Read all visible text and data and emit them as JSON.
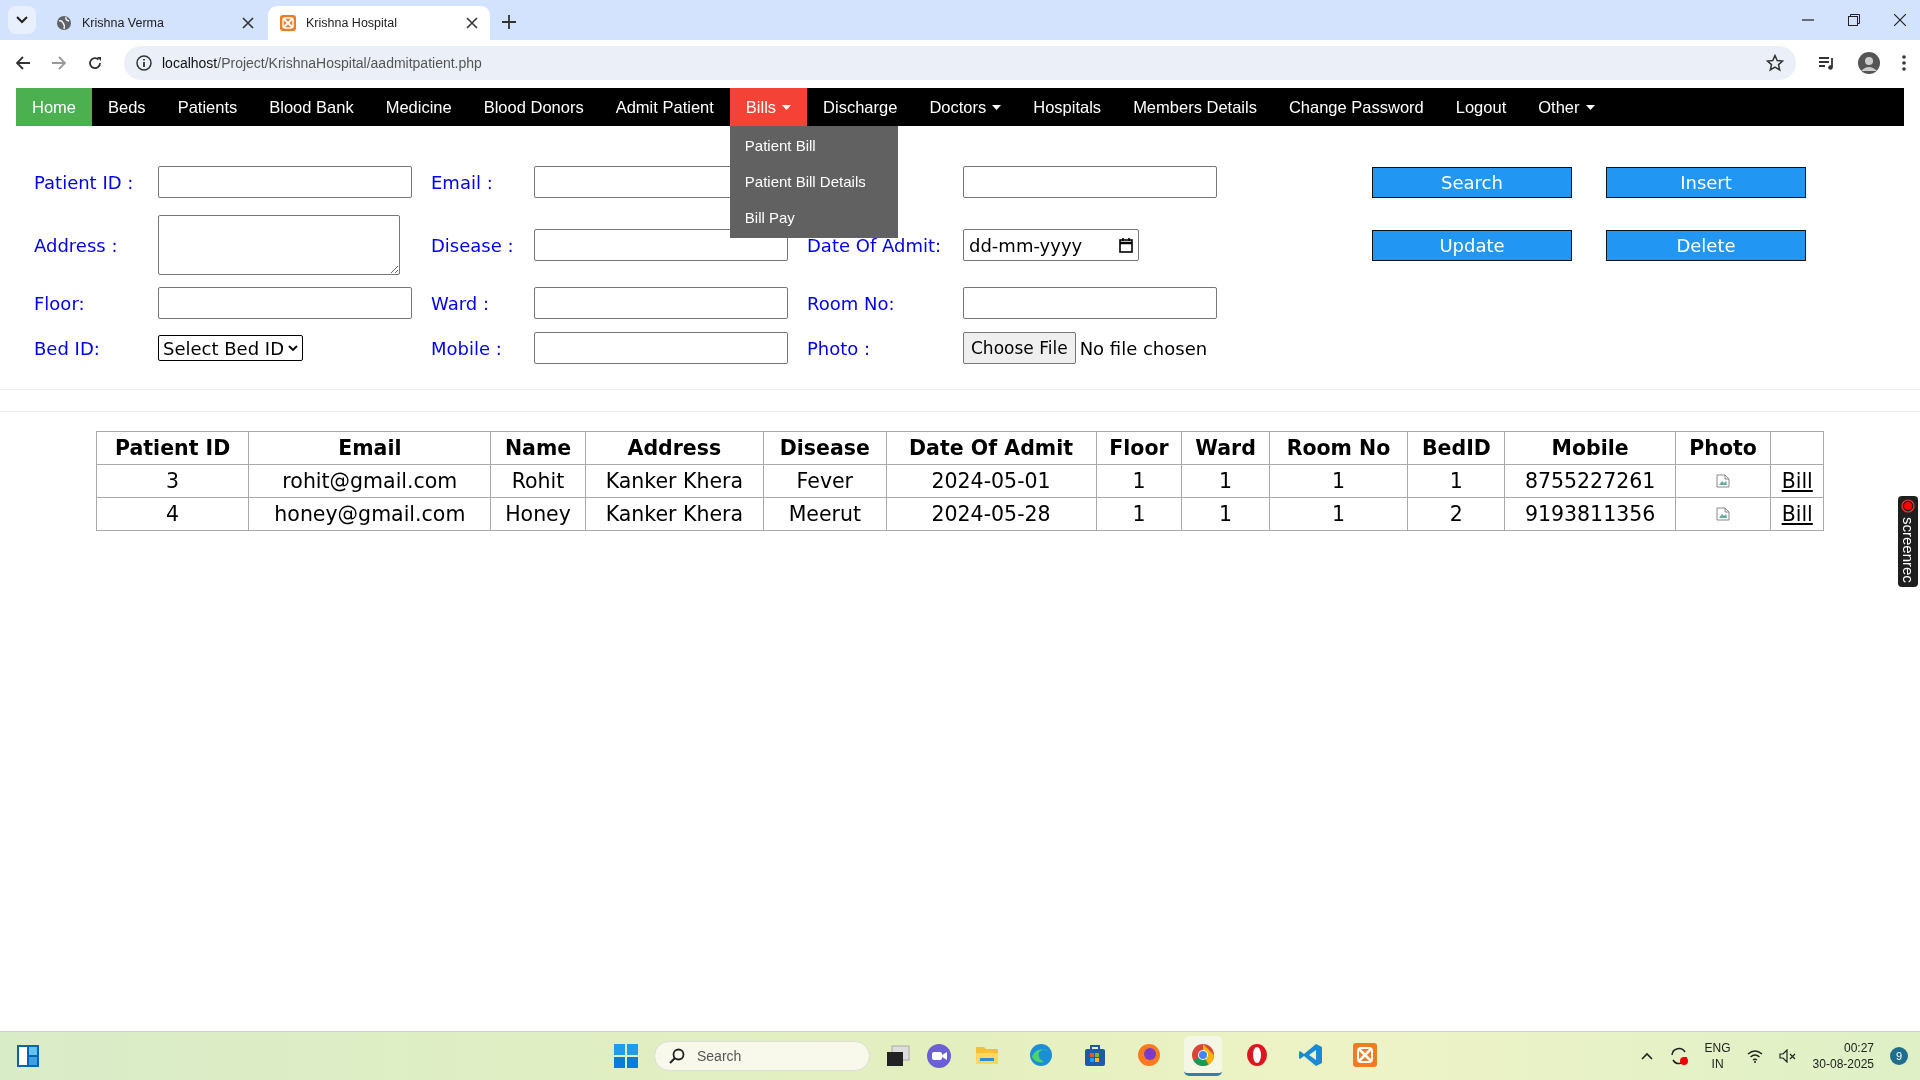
{
  "browser": {
    "tabs": [
      {
        "title": "Krishna Verma",
        "selected": false
      },
      {
        "title": "Krishna Hospital",
        "selected": true
      }
    ],
    "url_host": "localhost",
    "url_path": "/Project/KrishnaHospital/aadmitpatient.php"
  },
  "nav": {
    "items": [
      {
        "label": "Home",
        "selected": true,
        "caret": false,
        "open": false
      },
      {
        "label": "Beds",
        "selected": false,
        "caret": false,
        "open": false
      },
      {
        "label": "Patients",
        "selected": false,
        "caret": false,
        "open": false
      },
      {
        "label": "Blood Bank",
        "selected": false,
        "caret": false,
        "open": false
      },
      {
        "label": "Medicine",
        "selected": false,
        "caret": false,
        "open": false
      },
      {
        "label": "Blood Donors",
        "selected": false,
        "caret": false,
        "open": false
      },
      {
        "label": "Admit Patient",
        "selected": false,
        "caret": false,
        "open": false
      },
      {
        "label": "Bills",
        "selected": false,
        "caret": true,
        "open": true
      },
      {
        "label": "Discharge",
        "selected": false,
        "caret": false,
        "open": false
      },
      {
        "label": "Doctors",
        "selected": false,
        "caret": true,
        "open": false
      },
      {
        "label": "Hospitals",
        "selected": false,
        "caret": false,
        "open": false
      },
      {
        "label": "Members Details",
        "selected": false,
        "caret": false,
        "open": false
      },
      {
        "label": "Change Password",
        "selected": false,
        "caret": false,
        "open": false
      },
      {
        "label": "Logout",
        "selected": false,
        "caret": false,
        "open": false
      },
      {
        "label": "Other",
        "selected": false,
        "caret": true,
        "open": false
      }
    ],
    "dropdown": [
      "Patient Bill",
      "Patient Bill Details",
      "Bill Pay"
    ]
  },
  "form": {
    "rows": [
      {
        "fields": [
          {
            "label": "Patient ID :",
            "kind": "text"
          },
          {
            "label": "Email :",
            "kind": "text"
          },
          {
            "kind": "text"
          }
        ],
        "buttons": [
          "Search",
          "Insert"
        ]
      },
      {
        "fields": [
          {
            "label": "Address :",
            "kind": "textarea"
          },
          {
            "label": "Disease :",
            "kind": "text"
          },
          {
            "label": "Date Of Admit:",
            "kind": "date",
            "placeholder": "dd-mm-yyyy"
          }
        ],
        "buttons": [
          "Update",
          "Delete"
        ]
      },
      {
        "fields": [
          {
            "label": "Floor:",
            "kind": "text"
          },
          {
            "label": "Ward :",
            "kind": "text"
          },
          {
            "label": "Room No:",
            "kind": "text"
          }
        ],
        "buttons": []
      },
      {
        "fields": [
          {
            "label": "Bed ID:",
            "kind": "select",
            "value": "Select Bed ID"
          },
          {
            "label": "Mobile :",
            "kind": "text"
          },
          {
            "label": "Photo :",
            "kind": "file",
            "button": "Choose File",
            "status": "No file chosen"
          }
        ],
        "buttons": []
      }
    ]
  },
  "table": {
    "columns": [
      "Patient ID",
      "Email",
      "Name",
      "Address",
      "Disease",
      "Date Of Admit",
      "Floor",
      "Ward",
      "Room No",
      "BedID",
      "Mobile",
      "Photo"
    ],
    "rows": [
      {
        "cells": [
          "3",
          "rohit@gmail.com",
          "Rohit",
          "Kanker Khera",
          "Fever",
          "2024-05-01",
          "1",
          "1",
          "1",
          "1",
          "8755227261"
        ],
        "link": "Bill"
      },
      {
        "cells": [
          "4",
          "honey@gmail.com",
          "Honey",
          "Kanker Khera",
          "Meerut",
          "2024-05-28",
          "1",
          "1",
          "1",
          "2",
          "9193811356"
        ],
        "link": "Bill"
      }
    ]
  },
  "recorder": {
    "label": "screenrec"
  },
  "taskbar": {
    "search_placeholder": "Search",
    "apps": [
      {
        "kind": "files",
        "selected": false
      },
      {
        "kind": "edge",
        "selected": false
      },
      {
        "kind": "store",
        "selected": false
      },
      {
        "kind": "firefox",
        "selected": false
      },
      {
        "kind": "chrome",
        "selected": true
      },
      {
        "kind": "opera",
        "selected": false
      },
      {
        "kind": "vscode",
        "selected": false
      },
      {
        "kind": "xampp",
        "selected": false
      }
    ],
    "lang": "ENG",
    "region": "IN",
    "time": "00:27",
    "date": "30-08-2025",
    "notifications": "9"
  }
}
